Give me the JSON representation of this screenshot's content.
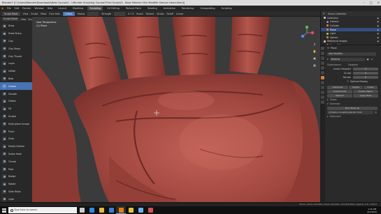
{
  "window": {
    "title": "Blender* [C:\\Users\\Blender\\Downloads\\New Course\\2 - Ultimate Sculpting Course\\Third Sculpt\\3 - Base Meshes Skin Modifier Demon Hand.blend]"
  },
  "menubar": {
    "menus": [
      "File",
      "Edit",
      "Render",
      "Window",
      "Help"
    ],
    "workspaces": [
      "Layout",
      "Modeling",
      "Sculpting",
      "UV Editing",
      "Texture Paint",
      "Shading",
      "Animation",
      "Rendering",
      "Compositing",
      "Scripting"
    ],
    "active_workspace": "Sculpting"
  },
  "tool_header": {
    "mode": "Sculpt Mode",
    "items": [
      "View",
      "Sculpt",
      "Mask",
      "Face Sets"
    ],
    "brush": "Crease",
    "radius": "Radius",
    "strength": "Strength",
    "symmetry": "X Y Z",
    "brush_settings": "Brush",
    "texture": "Texture",
    "stroke": "Stroke",
    "falloff": "Falloff",
    "cursor": "Cursor"
  },
  "tool_header2": {
    "items": [
      "Sculpt Mode",
      "View",
      "Sculpt",
      "Mask",
      "Face Sets"
    ]
  },
  "tools": [
    "Draw",
    "Draw Sharp",
    "Clay",
    "Clay Strips",
    "Clay Thumb",
    "Layer",
    "Inflate",
    "Blob",
    "Crease",
    "Smooth",
    "Flatten",
    "Fill",
    "Scrape",
    "Multi-plane Scrape",
    "Pinch",
    "Grab",
    "Elastic Deform",
    "Snake Hook",
    "Thumb",
    "Pose",
    "Nudge",
    "Rotate",
    "Slide Relax",
    "Cloth",
    "Simplify",
    "Mask"
  ],
  "active_tool": "Crease",
  "viewport": {
    "view_label": "User Perspective",
    "object_label": "(1) Plane"
  },
  "outliner": {
    "header": "Scene Collection",
    "rows": [
      {
        "name": "Collection",
        "color": "#cfcfcf",
        "selected": false
      },
      {
        "name": "Camera",
        "color": "#9a7fd1",
        "selected": false
      },
      {
        "name": "Cylinder",
        "color": "#e08a3a",
        "selected": false
      },
      {
        "name": "Plane",
        "color": "#e08a3a",
        "selected": true
      },
      {
        "name": "Light",
        "color": "#9fd06a",
        "selected": false
      },
      {
        "name": "Sphere",
        "color": "#e08a3a",
        "selected": false
      },
      {
        "name": "Reference Images",
        "color": "#cfcfcf",
        "selected": false
      },
      {
        "name": "Plane.001",
        "color": "#e08a3a",
        "selected": false
      }
    ]
  },
  "properties": {
    "object_name": "Plane",
    "add_modifier": "Add Modifier",
    "modifier_name": "Multires",
    "subdivisions_header": "Subdivisions",
    "viewport_label": "Viewport",
    "fields": [
      {
        "label": "Levels Viewport",
        "value": "3"
      },
      {
        "label": "Sculpt",
        "value": "3"
      },
      {
        "label": "Render",
        "value": "3"
      }
    ],
    "optimal_display": "Optimal Display",
    "buttons": [
      "Subdivide",
      "Simple",
      "Linear",
      "Unsubdivide",
      "Delete Higher",
      "Rebuild",
      "Apply Base"
    ],
    "shape_header": "Shape",
    "generate_header": "Generate",
    "pack_button": "Pack External",
    "file_path": "//3-Demon Sculpting Render 2.btx",
    "advanced": "Advanced"
  },
  "status": {
    "text": "Plane | Verts 419,906 | Faces 419,904 | Tris 839,808 | Objects 1/5 | 2.83.0"
  },
  "taskbar": {
    "search_placeholder": "Type here to search",
    "apps": [
      {
        "name": "task-view",
        "color": "#cccccc"
      },
      {
        "name": "edge",
        "color": "#2f8ae0"
      },
      {
        "name": "file-explorer",
        "color": "#e8b938"
      },
      {
        "name": "store",
        "color": "#3b7fd1"
      },
      {
        "name": "blender",
        "color": "#e87d0d"
      },
      {
        "name": "chrome",
        "color": "#e2c23a"
      },
      {
        "name": "photos",
        "color": "#6ab0e8"
      },
      {
        "name": "paint",
        "color": "#d95050"
      }
    ],
    "active_app": "blender",
    "time": "1:34 PM",
    "date": "8/1/2020"
  },
  "colors": {
    "accent": "#4772b3",
    "skin_base": "#a0473f",
    "skin_light": "#c26157",
    "skin_dark": "#6e2a26",
    "viewport_bg": "#3a3a3a"
  }
}
